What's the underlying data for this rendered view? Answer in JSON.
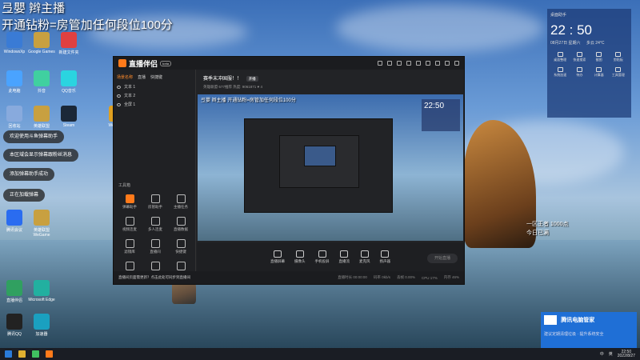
{
  "overlay": {
    "line1": "弖嬰 辫主播",
    "line2": "开通钻粉=房管加任何段位100分"
  },
  "desktop_icons": [
    {
      "label": "WindowsXp",
      "color": "#3a7bd5"
    },
    {
      "label": "Google Games",
      "color": "#c8a040"
    },
    {
      "label": "新建文件夹",
      "color": "#e04040"
    },
    {
      "label": "此电脑",
      "color": "#4aa3ff"
    },
    {
      "label": "抖音",
      "color": "#40d0a0"
    },
    {
      "label": "QQ音乐",
      "color": "#2ad4e0"
    },
    {
      "label": "回收站",
      "color": "#88aadd"
    },
    {
      "label": "英雄联盟",
      "color": "#c8a040"
    },
    {
      "label": "Steam",
      "color": "#1b2838"
    },
    {
      "label": "WeGame",
      "color": "#e0a020"
    },
    {
      "label": "腾讯会议",
      "color": "#2a6cf0"
    },
    {
      "label": "英雄联盟WeGame",
      "color": "#c8a040"
    },
    {
      "label": "直播伴侣",
      "color": "#30a060"
    },
    {
      "label": "Microsoft Edge",
      "color": "#22b0a0"
    },
    {
      "label": "腾讯QQ",
      "color": "#222"
    },
    {
      "label": "加速器",
      "color": "#1aa0c0"
    }
  ],
  "toasts": [
    "欢迎使用斗鱼弹幕助手",
    "本区域会显示弹幕跟粉丝消息",
    "添加弹幕助手成功",
    "正在加载弹幕"
  ],
  "app": {
    "name": "直播伴侣",
    "badge": "beta",
    "scene_tabs": [
      "场景名称",
      "直播",
      "快捷键"
    ],
    "sources": [
      "文本 1",
      "文本 2",
      "全屏 1"
    ],
    "tools_title": "工具箱",
    "tools": [
      {
        "label": "弹幕助手",
        "hot": true
      },
      {
        "label": "房管助手",
        "hot": false
      },
      {
        "label": "主播任务",
        "hot": false
      },
      {
        "label": "视频连麦",
        "hot": false
      },
      {
        "label": "多人连麦",
        "hot": false
      },
      {
        "label": "直播数据",
        "hot": false
      },
      {
        "label": "滤镜库",
        "hot": false
      },
      {
        "label": "直播间",
        "hot": false
      },
      {
        "label": "快捷键",
        "hot": false
      },
      {
        "label": "更多",
        "hot": false
      },
      {
        "label": "开播提醒",
        "hot": false
      },
      {
        "label": "设置",
        "hot": false
      }
    ],
    "stream_title": "赛季末冲国服！！",
    "stream_tag": "开播",
    "stream_meta": "英雄联盟·577推荐    热度: 9061871   ♥ 4",
    "preview_text": "弖嬰 辫主播 开通钻粉=房管加任何段位100分",
    "preview_clock": "22:50",
    "bottom_actions": [
      "直播屏幕",
      "摄像头",
      "手机投屏",
      "直播流",
      "麦克风",
      "扬声器"
    ],
    "go_live": "开始直播",
    "status_items": [
      "直播时长 00:00:00",
      "码率 0kb/s",
      "丢帧 0.00%",
      "CPU 17%",
      "内存 46%"
    ],
    "status_note": "直播间页面需更新？点击此处可同步到直播间"
  },
  "clock_widget": {
    "title": "桌面助手",
    "time": "22 : 50",
    "date": "08月27日 星期六",
    "weather": "多云 24°C",
    "items": [
      "桌面整理",
      "快速搜索",
      "截图",
      "剪贴板",
      "系统加速",
      "待办",
      "计算器",
      "工具管理"
    ]
  },
  "right_caption": {
    "line1": "一区王者 1000点",
    "line2": "今日已满"
  },
  "ad": {
    "title": "腾讯电脑管家",
    "sub": "建议定期清理垃圾 · 提升系统安全"
  },
  "taskbar": {
    "lang": "中",
    "input": "英",
    "time": "22:50",
    "date": "2022/8/27"
  }
}
